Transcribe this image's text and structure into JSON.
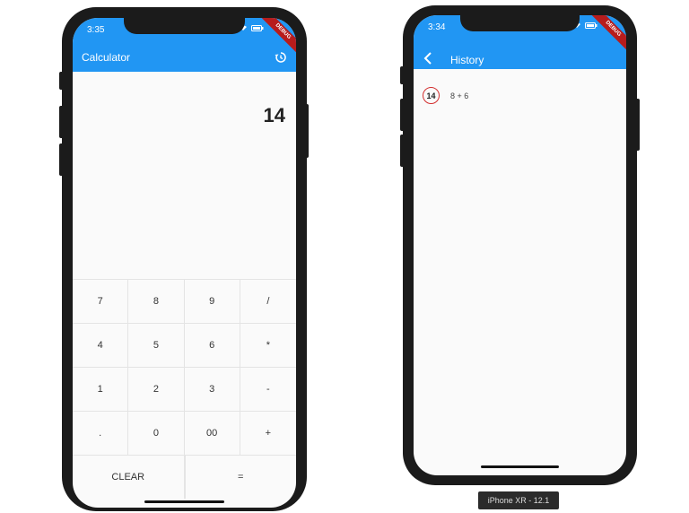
{
  "left": {
    "status_time": "3:35",
    "title": "Calculator",
    "display": "14",
    "keys": [
      "7",
      "8",
      "9",
      "/",
      "4",
      "5",
      "6",
      "*",
      "1",
      "2",
      "3",
      "-",
      ".",
      "0",
      "00",
      "+"
    ],
    "clear_label": "CLEAR",
    "equals_label": "=",
    "ribbon": "DEBUG"
  },
  "right": {
    "status_time": "3:34",
    "title": "History",
    "history": [
      {
        "result": "14",
        "expression": "8 + 6"
      }
    ],
    "ribbon": "DEBUG"
  },
  "device_label": "iPhone XR - 12.1",
  "colors": {
    "appbar": "#2196f3",
    "result_ring": "#d32f2f"
  },
  "icons": {
    "history": "history-icon",
    "back": "back-arrow-icon"
  }
}
